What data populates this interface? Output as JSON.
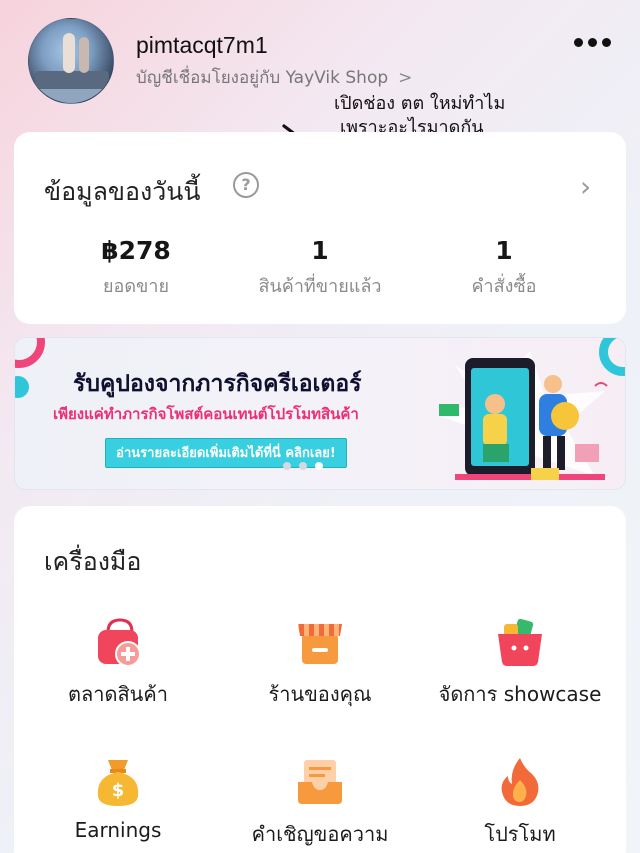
{
  "profile": {
    "username": "pimtacqt7m1",
    "linked_text": "บัญชีเชื่อมโยงอยู่กับ YayVik Shop",
    "chevron": ">"
  },
  "annotation": {
    "line1": "เปิดช่อง ตต ใหม่ทำไม",
    "line2": "เพราะอะไรมาดูกัน"
  },
  "today": {
    "title": "ข้อมูลของวันนี้",
    "help": "?",
    "chevron": "›",
    "stats": [
      {
        "value": "฿278",
        "label": "ยอดขาย"
      },
      {
        "value": "1",
        "label": "สินค้าที่ขายแล้ว"
      },
      {
        "value": "1",
        "label": "คำสั่งซื้อ"
      }
    ]
  },
  "banner": {
    "title": "รับคูปองจากภารกิจครีเอเตอร์",
    "subtitle": "เพียงแค่ทำภารกิจโพสต์คอนเทนต์โปรโมทสินค้า",
    "button": "อ่านรายละเอียดเพิ่มเติมได้ที่นี่ คลิกเลย!"
  },
  "tools": {
    "title": "เครื่องมือ",
    "items": [
      {
        "label": "ตลาดสินค้า",
        "icon": "shopping-bag-plus-icon"
      },
      {
        "label": "ร้านของคุณ",
        "icon": "storefront-icon"
      },
      {
        "label": "จัดการ showcase",
        "icon": "basket-icon"
      },
      {
        "label": "Earnings",
        "icon": "money-bag-icon"
      },
      {
        "label": "คำเชิญขอความ",
        "icon": "inbox-icon"
      },
      {
        "label": "โปรโมท",
        "icon": "fire-icon"
      }
    ]
  },
  "colors": {
    "accent_pink": "#f0457a",
    "accent_teal": "#38cfe0",
    "icon_red": "#f0455a",
    "icon_orange": "#f79a3e",
    "icon_gold": "#f6b733"
  }
}
